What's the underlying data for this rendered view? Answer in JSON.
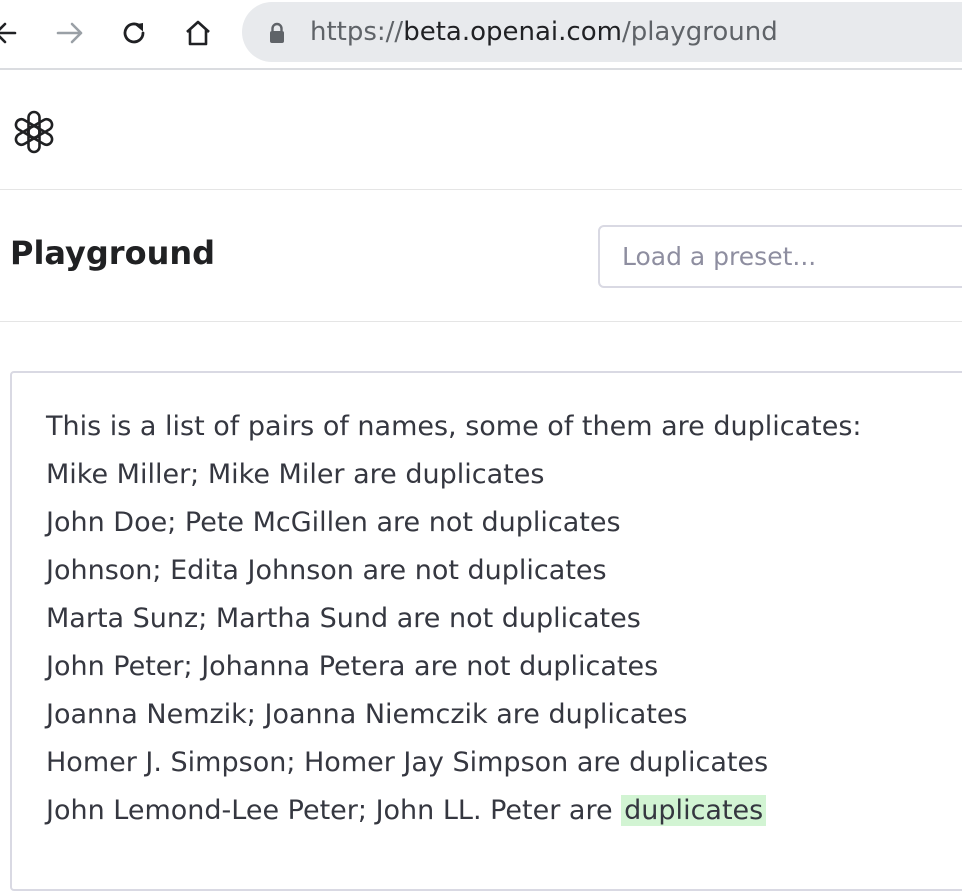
{
  "browser": {
    "icons": [
      "back-icon",
      "forward-icon",
      "reload-icon",
      "home-icon",
      "lock-icon"
    ],
    "url_scheme": "https://",
    "url_host": "beta.openai.com",
    "url_path": "/playground"
  },
  "header": {
    "logo_icon": "openai-logo-icon"
  },
  "toolbar": {
    "title": "Playground",
    "preset_placeholder": "Load a preset..."
  },
  "editor": {
    "lines": [
      "This is a list of pairs of names, some of them are duplicates:",
      "Mike Miller; Mike Miler are duplicates",
      "John Doe; Pete McGillen are not duplicates",
      "Johnson; Edita Johnson are not duplicates",
      "Marta Sunz; Martha Sund are not duplicates",
      "John Peter; Johanna Petera are not duplicates",
      "Joanna Nemzik; Joanna Niemczik are duplicates",
      "Homer J. Simpson; Homer Jay Simpson are duplicates"
    ],
    "last_line_prompt": "John Lemond-Lee Peter; John LL. Peter are ",
    "last_line_completion": "duplicates",
    "completion_highlight_color": "#d2f4d3"
  }
}
